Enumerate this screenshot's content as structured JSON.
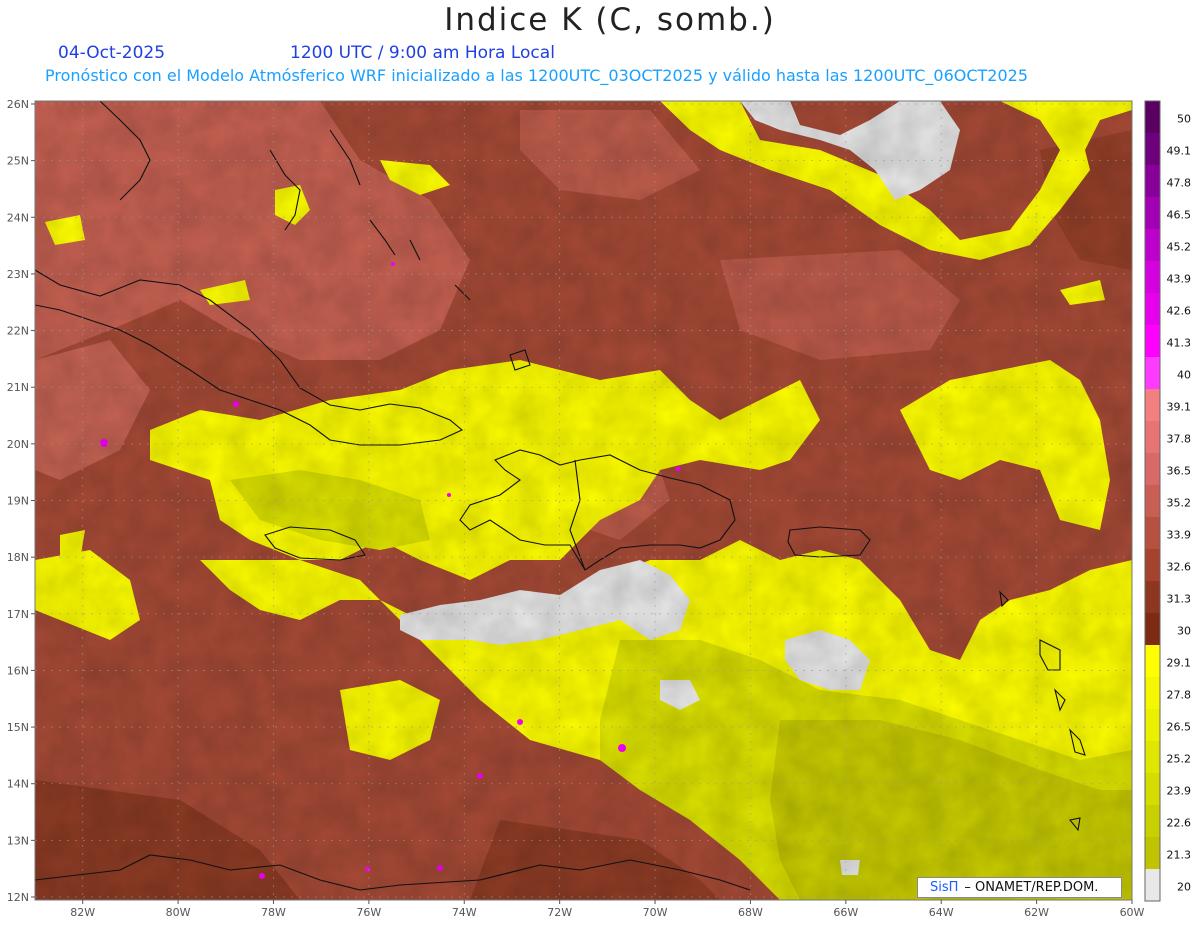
{
  "title": "Indice K (C, somb.)",
  "date": "04-Oct-2025",
  "valid_time": "1200 UTC / 9:00 am Hora Local",
  "forecast_line": "Pronóstico con el Modelo Atmósferico WRF inicializado a las 1200UTC_03OCT2025 y válido hasta las  1200UTC_06OCT2025",
  "credit": {
    "brand": "SisΠ",
    "text": "– ONAMET/REP.DOM."
  },
  "lat_labels": [
    "26N",
    "25N",
    "24N",
    "23N",
    "22N",
    "21N",
    "20N",
    "19N",
    "18N",
    "17N",
    "16N",
    "15N",
    "14N",
    "13N",
    "12N"
  ],
  "lon_labels": [
    "82W",
    "80W",
    "78W",
    "76W",
    "74W",
    "72W",
    "70W",
    "68W",
    "66W",
    "64W",
    "62W",
    "60W"
  ],
  "colorbar": {
    "labels": [
      "50",
      "49.1",
      "47.8",
      "46.5",
      "45.2",
      "43.9",
      "42.6",
      "41.3",
      "40",
      "39.1",
      "37.8",
      "36.5",
      "35.2",
      "33.9",
      "32.6",
      "31.3",
      "30",
      "29.1",
      "27.8",
      "26.5",
      "25.2",
      "23.9",
      "22.6",
      "21.3",
      "20"
    ],
    "colors": [
      "#5a0063",
      "#6e007e",
      "#880099",
      "#a300b4",
      "#bd00cc",
      "#d500e0",
      "#e800ee",
      "#ff00ff",
      "#ff3aff",
      "#f28080",
      "#e67474",
      "#d96868",
      "#c95e55",
      "#b8503f",
      "#a5432f",
      "#8f3620",
      "#7d2b12",
      "#ffff00",
      "#f5f700",
      "#eaf000",
      "#dfe600",
      "#d4dc00",
      "#c9d000",
      "#c0c400",
      "#e8e8e8"
    ]
  },
  "map": {
    "variable": "K index",
    "units": "C",
    "lat_range": [
      12,
      26
    ],
    "lon_range": [
      -83,
      -60
    ],
    "field_colors": {
      "very_high": "#ff00ff",
      "high_light": "#e07068",
      "high": "#c5604e",
      "high_dark": "#a64a36",
      "high_deep": "#8a3a22",
      "mid_yellow": "#ffff00",
      "low_yellow": "#dde300",
      "lower_yellow": "#c8cc00",
      "low": "#e8e8e8"
    }
  }
}
